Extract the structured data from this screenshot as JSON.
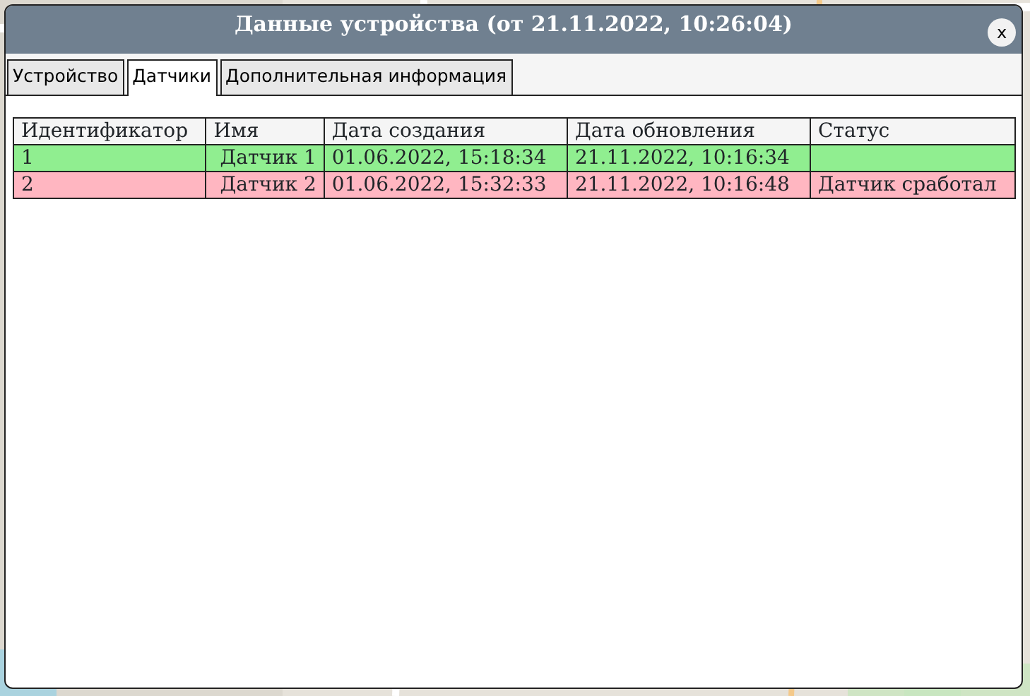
{
  "window": {
    "title": "Данные устройства (от 21.11.2022, 10:26:04)",
    "close": "x"
  },
  "tabs": [
    {
      "label": "Устройство",
      "selected": false
    },
    {
      "label": "Датчики",
      "selected": true
    },
    {
      "label": "Дополнительная информация",
      "selected": false
    }
  ],
  "table": {
    "columns": [
      "Идентификатор",
      "Имя",
      "Дата создания",
      "Дата обновления",
      "Статус"
    ],
    "rows": [
      {
        "id": "1",
        "name": "Датчик 1",
        "created": "01.06.2022, 15:18:34",
        "updated": "21.11.2022, 10:16:34",
        "color": "#90ee90"
      },
      {
        "id": "2",
        "name": "Датчик 2",
        "created": "01.06.2022, 15:32:33",
        "updated": "21.11.2022, 10:16:48",
        "status": "Датчик сработал",
        "color": "#ffb6c1"
      }
    ]
  }
}
